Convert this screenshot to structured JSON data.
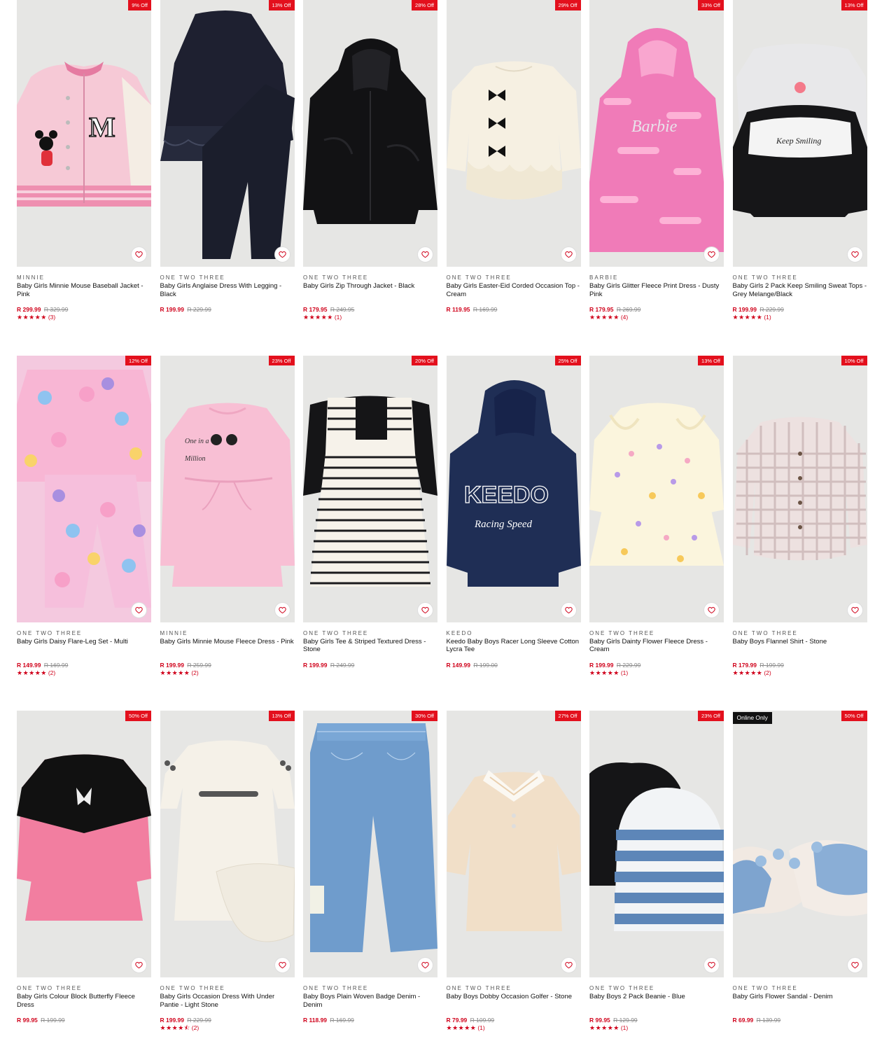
{
  "products": [
    {
      "brand": "MINNIE",
      "name": "Baby Girls Minnie Mouse Baseball Jacket - Pink",
      "price": "R 299.99",
      "was": "R 329.99",
      "badge": "9% Off",
      "stars": "★★★★★",
      "count": "(3)",
      "art": "jacket-pink"
    },
    {
      "brand": "ONE TWO THREE",
      "name": "Baby Girls Anglaise Dress With Legging - Black",
      "price": "R 199.99",
      "was": "R 229.99",
      "badge": "13% Off",
      "stars": "",
      "count": "",
      "art": "dress-black"
    },
    {
      "brand": "ONE TWO THREE",
      "name": "Baby Girls Zip Through Jacket - Black",
      "price": "R 179.95",
      "was": "R 249.95",
      "badge": "28% Off",
      "stars": "★★★★★",
      "count": "(1)",
      "art": "fur-black"
    },
    {
      "brand": "ONE TWO THREE",
      "name": "Baby Girls Easter-Eid Corded Occasion Top - Cream",
      "price": "R 119.95",
      "was": "R 169.99",
      "badge": "29% Off",
      "stars": "",
      "count": "",
      "art": "top-cream"
    },
    {
      "brand": "BARBIE",
      "name": "Baby Girls Glitter Fleece Print Dress - Dusty Pink",
      "price": "R 179.95",
      "was": "R 269.99",
      "badge": "33% Off",
      "stars": "★★★★★",
      "count": "(4)",
      "art": "barbie-pink"
    },
    {
      "brand": "ONE TWO THREE",
      "name": "Baby Girls 2 Pack Keep Smiling Sweat Tops - Grey Melange/Black",
      "price": "R 199.99",
      "was": "R 229.99",
      "badge": "13% Off",
      "stars": "★★★★★",
      "count": "(1)",
      "art": "sweat-2pack"
    },
    {
      "brand": "ONE TWO THREE",
      "name": "Baby Girls Daisy Flare-Leg Set - Multi",
      "price": "R 149.99",
      "was": "R 169.99",
      "badge": "12% Off",
      "stars": "★★★★★",
      "count": "(2)",
      "art": "daisy-set"
    },
    {
      "brand": "MINNIE",
      "name": "Baby Girls Minnie Mouse Fleece Dress - Pink",
      "price": "R 199.99",
      "was": "R 259.99",
      "badge": "23% Off",
      "stars": "★★★★★",
      "count": "(2)",
      "art": "dress-pink"
    },
    {
      "brand": "ONE TWO THREE",
      "name": "Baby Girls Tee & Striped Textured Dress - Stone",
      "price": "R 199.99",
      "was": "R 249.99",
      "badge": "20% Off",
      "stars": "",
      "count": "",
      "art": "striped-dress"
    },
    {
      "brand": "KEEDO",
      "name": "Keedo Baby Boys Racer Long Sleeve Cotton Lycra Tee",
      "price": "R 149.99",
      "was": "R 199.00",
      "badge": "25% Off",
      "stars": "",
      "count": "",
      "art": "hoodie-navy"
    },
    {
      "brand": "ONE TWO THREE",
      "name": "Baby Girls Dainty Flower Fleece Dress - Cream",
      "price": "R 199.99",
      "was": "R 229.99",
      "badge": "13% Off",
      "stars": "★★★★★",
      "count": "(1)",
      "art": "flower-dress"
    },
    {
      "brand": "ONE TWO THREE",
      "name": "Baby Boys Flannel Shirt - Stone",
      "price": "R 179.99",
      "was": "R 199.99",
      "badge": "10% Off",
      "stars": "★★★★★",
      "count": "(2)",
      "art": "flannel-shirt"
    },
    {
      "brand": "ONE TWO THREE",
      "name": "Baby Girls Colour Block Butterfly Fleece Dress",
      "price": "R 99.95",
      "was": "R 199.99",
      "badge": "50% Off",
      "stars": "",
      "count": "",
      "art": "colorblock-dress"
    },
    {
      "brand": "ONE TWO THREE",
      "name": "Baby Girls Occasion Dress With Under Pantie - Light Stone",
      "price": "R 199.99",
      "was": "R 229.99",
      "badge": "13% Off",
      "stars": "★★★★⯪",
      "count": "(2)",
      "art": "occasion-dress"
    },
    {
      "brand": "ONE TWO THREE",
      "name": "Baby Boys Plain Woven Badge Denim - Denim",
      "price": "R 118.99",
      "was": "R 169.99",
      "badge": "30% Off",
      "stars": "",
      "count": "",
      "art": "denim"
    },
    {
      "brand": "ONE TWO THREE",
      "name": "Baby Boys Dobby Occasion Golfer - Stone",
      "price": "R 79.99",
      "was": "R 109.99",
      "badge": "27% Off",
      "stars": "★★★★★",
      "count": "(1)",
      "art": "golfer"
    },
    {
      "brand": "ONE TWO THREE",
      "name": "Baby Boys 2 Pack Beanie - Blue",
      "price": "R 99.95",
      "was": "R 129.99",
      "badge": "23% Off",
      "stars": "★★★★★",
      "count": "(1)",
      "art": "beanies"
    },
    {
      "brand": "ONE TWO THREE",
      "name": "Baby Girls Flower Sandal - Denim",
      "price": "R 69.99",
      "was": "R 139.99",
      "badge": "50% Off",
      "badge_left": "Online Only",
      "stars": "",
      "count": "",
      "art": "sandals"
    }
  ]
}
